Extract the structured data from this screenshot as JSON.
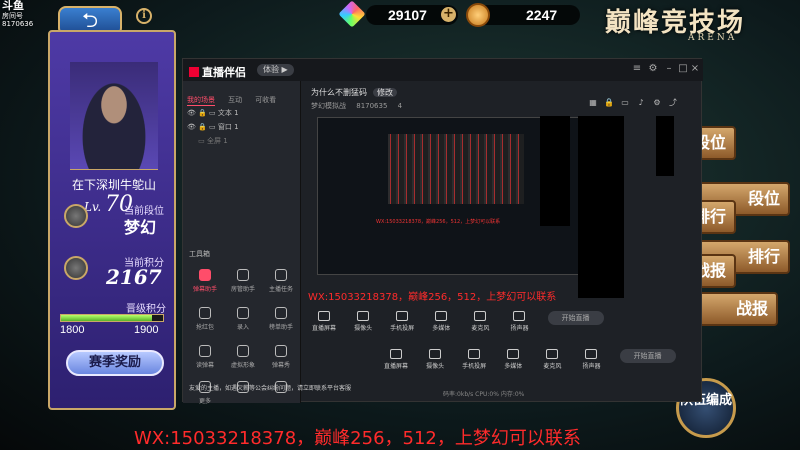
{
  "watermark": {
    "brand": "斗鱼",
    "sub": "房间号",
    "room": "8170636"
  },
  "topbar": {
    "back_icon": "back-arrow-icon",
    "info": "i",
    "gems": "29107",
    "plus": "+",
    "coins": "2247"
  },
  "arena": {
    "title": "巅峰竞技场",
    "subtitle": "ARENA"
  },
  "profile": {
    "name": "在下深圳牛鸵山",
    "lv_prefix": "Lv.",
    "lv": "70",
    "rank_label": "当前段位",
    "rank": "梦幻",
    "points_label": "当前积分",
    "points": "2167",
    "promo_label": "晋级积分",
    "progress": 0.89,
    "progress_min": "1800",
    "progress_max": "1900",
    "reward_btn": "赛季奖励"
  },
  "game_buttons": [
    "段位",
    "排行",
    "战报",
    "队伍编成"
  ],
  "team_btn": "队伍\n编成",
  "obs": {
    "app_name": "直播伴侣",
    "tag": "体验 ▶",
    "tabs": [
      "我的场景",
      "互动",
      "可收看"
    ],
    "sources": [
      "文本 1",
      "窗口 1",
      "全屏 1"
    ],
    "toolbox_label": "工具箱",
    "tools": [
      "弹幕助手",
      "房管助手",
      "主播任务",
      "抢红包",
      "录入",
      "榜单助手",
      "读弹幕",
      "虚拟形象",
      "弹幕秀",
      "更多",
      "",
      ""
    ],
    "notice": "友爱的主播，如遇欠薪等公会纠纷问题，请立即联系平台客服",
    "stream_title": "为什么不删猛码",
    "edit": "修改",
    "category": "梦幻模拟战",
    "room_no": "8170635",
    "fans": "4",
    "controls": [
      "直播屏幕",
      "摄像头",
      "手机投屏",
      "多媒体",
      "麦克风",
      "扬声器"
    ],
    "live_btn": "开始直播",
    "status": "码率:0kb/s  CPU:0%  内存:0%"
  },
  "overlay_text": "WX:15033218378，巅峰256，512，上梦幻可以联系",
  "bottom_text": "WX:15033218378，巅峰256，512，上梦幻可以联系"
}
